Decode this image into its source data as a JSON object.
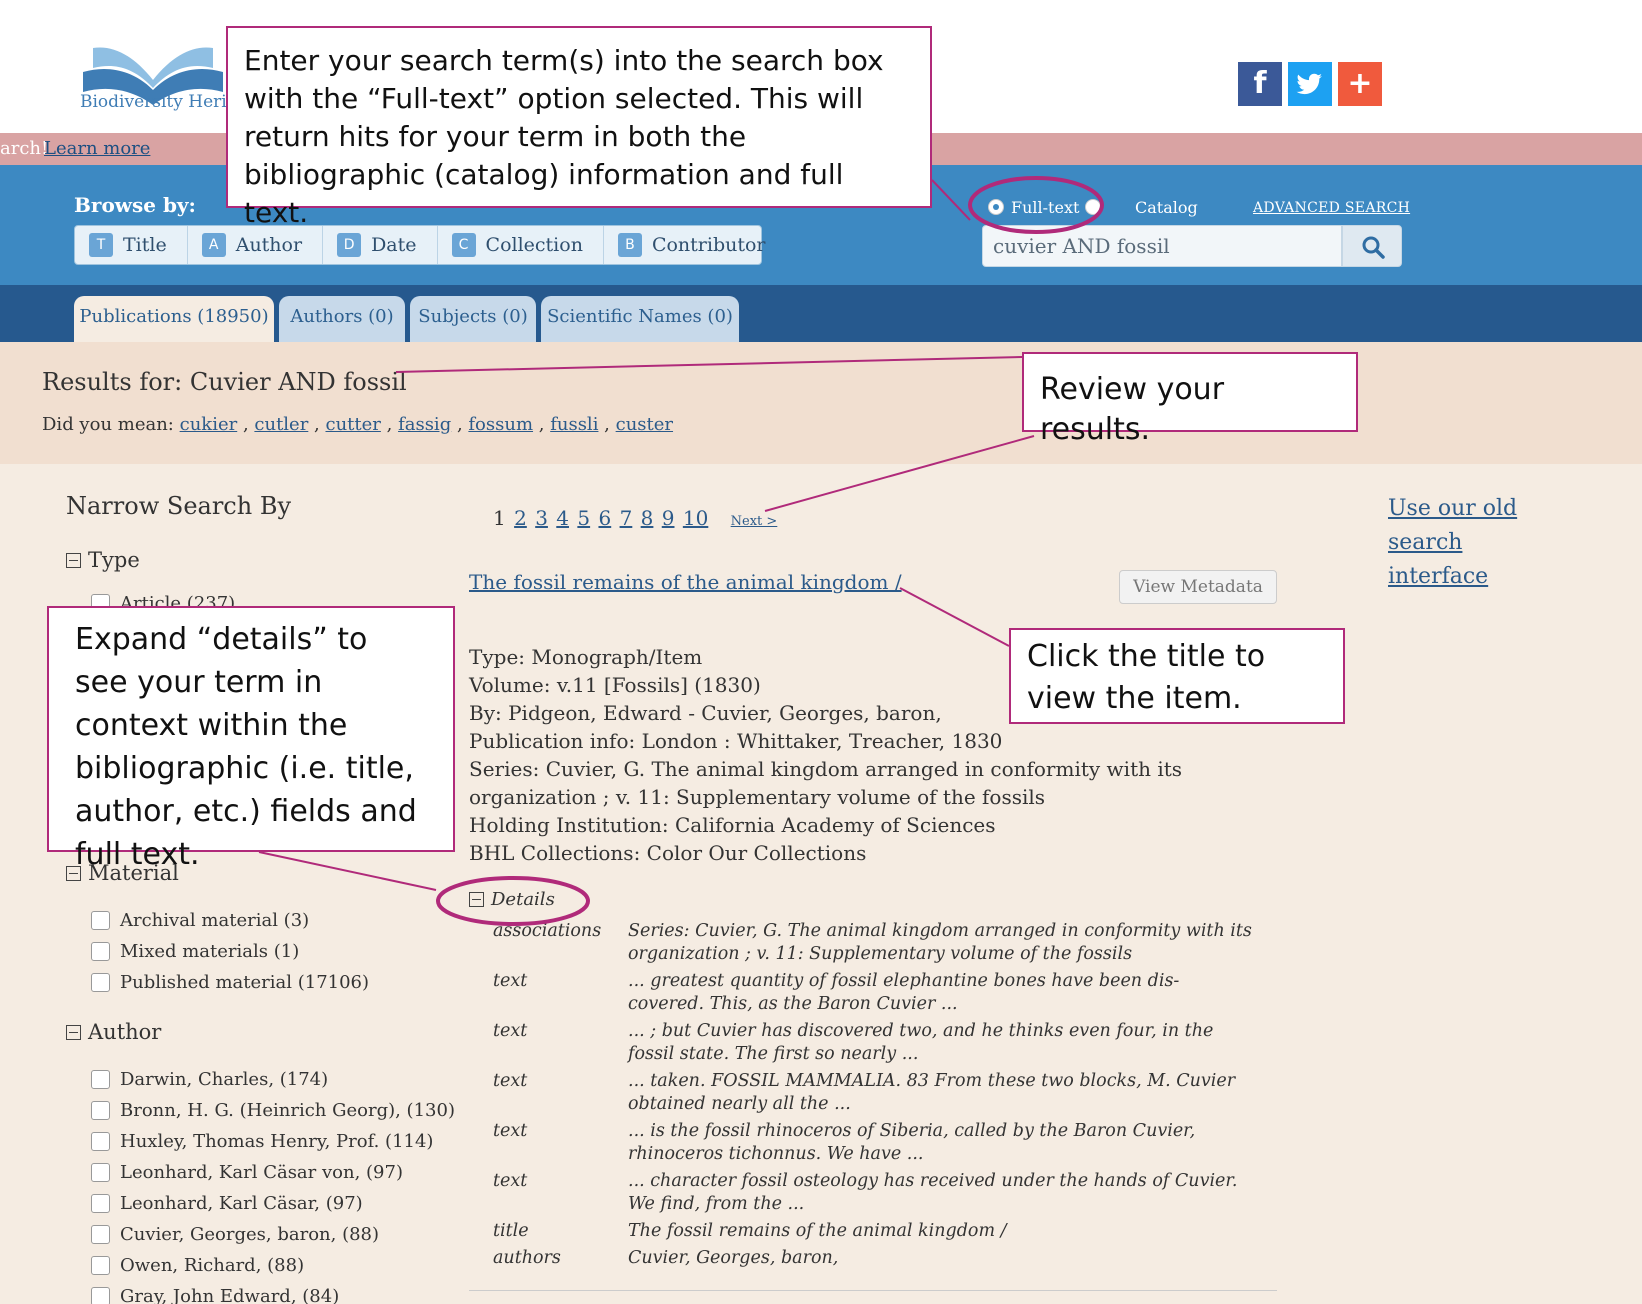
{
  "header": {
    "logo_text": "Biodiversity Heri",
    "social": {
      "facebook": "f",
      "twitter": "t",
      "plus": "+"
    }
  },
  "banner": {
    "text": "arch!",
    "link": "Learn more",
    "period": "."
  },
  "browse": {
    "label": "Browse by:",
    "buttons": [
      {
        "label": "Title",
        "icon": "T"
      },
      {
        "label": "Author",
        "icon": "A"
      },
      {
        "label": "Date",
        "icon": "D"
      },
      {
        "label": "Collection",
        "icon": "C"
      },
      {
        "label": "Contributor",
        "icon": "B"
      }
    ]
  },
  "search": {
    "option_fulltext": "Full-text",
    "option_catalog": "Catalog",
    "advanced": "ADVANCED SEARCH",
    "query": "cuvier AND fossil"
  },
  "tabs": [
    {
      "label": "Publications (18950)"
    },
    {
      "label": "Authors (0)"
    },
    {
      "label": "Subjects (0)"
    },
    {
      "label": "Scientific Names (0)"
    }
  ],
  "results_header": {
    "title": "Results for: Cuvier AND fossil",
    "did_you_mean_label": "Did you mean:",
    "suggestions": [
      "cukier",
      "cutler",
      "cutter",
      "fassig",
      "fossum",
      "fussli",
      "custer"
    ]
  },
  "sidebar": {
    "title": "Narrow Search By",
    "type_label": "Type",
    "type_partial_item": "Article (237)",
    "material_label": "Material",
    "material_items": [
      "Archival material (3)",
      "Mixed materials (1)",
      "Published material (17106)"
    ],
    "author_label": "Author",
    "author_items": [
      "Darwin, Charles, (174)",
      "Bronn, H. G. (Heinrich Georg), (130)",
      "Huxley, Thomas Henry, Prof. (114)",
      "Leonhard, Karl Cäsar von, (97)",
      "Leonhard, Karl Cäsar, (97)",
      "Cuvier, Georges, baron, (88)",
      "Owen, Richard, (88)",
      "Gray, John Edward, (84)"
    ]
  },
  "old_search": "Use our old search interface",
  "pager": {
    "pages": [
      "1",
      "2",
      "3",
      "4",
      "5",
      "6",
      "7",
      "8",
      "9",
      "10"
    ],
    "next": "Next >"
  },
  "result": {
    "title": "The fossil remains of the animal kingdom /",
    "view_metadata": "View Metadata",
    "type": "Type: Monograph/Item",
    "volume": "Volume: v.11 [Fossils] (1830)",
    "by": "By: Pidgeon, Edward - Cuvier, Georges, baron,",
    "pubinfo": "Publication info: London : Whittaker, Treacher, 1830",
    "series": "Series: Cuvier, G. The animal kingdom arranged in conformity with its organization ; v. 11: Supplementary volume of the fossils",
    "holding": "Holding Institution: California Academy of Sciences",
    "collections": "BHL Collections: Color Our Collections",
    "details_label": "Details",
    "details": [
      {
        "key": "associations",
        "val": "Series: Cuvier, G. The animal kingdom arranged in conformity with its organization ; v. 11: Supplementary volume of the fossils"
      },
      {
        "key": "text",
        "val": "... greatest quantity of fossil elephantine bones have been dis- covered. This, as the Baron Cuvier ..."
      },
      {
        "key": "text",
        "val": "... ; but Cuvier has discovered two, and he thinks even four, in the fossil state. The first so nearly ..."
      },
      {
        "key": "text",
        "val": "... taken. FOSSIL MAMMALIA. 83 From these two blocks, M. Cuvier obtained nearly all the ..."
      },
      {
        "key": "text",
        "val": "... is the fossil rhinoceros of Siberia, called by the Baron Cuvier, rhinoceros tichonnus. We have ..."
      },
      {
        "key": "text",
        "val": "... character fossil osteology has received under the hands of Cuvier. We find, from the ..."
      },
      {
        "key": "title",
        "val": "The fossil remains of the animal kingdom /"
      },
      {
        "key": "authors",
        "val": "Cuvier, Georges, baron,"
      }
    ]
  },
  "annotations": {
    "search": "Enter your search term(s) into the search box with the “Full-text” option selected. This will return hits for your term in both the bibliographic (catalog) information and full text.",
    "review": "Review your results.",
    "click_title": "Click the title to view the item.",
    "details": "Expand “details” to see your term in context within the bibliographic (i.e. title, author, etc.) fields and full text."
  },
  "colors": {
    "annotation": "#b02a7a",
    "header_blue": "#3d89c2",
    "tab_bar": "#26598e",
    "link": "#2b5a8a"
  }
}
